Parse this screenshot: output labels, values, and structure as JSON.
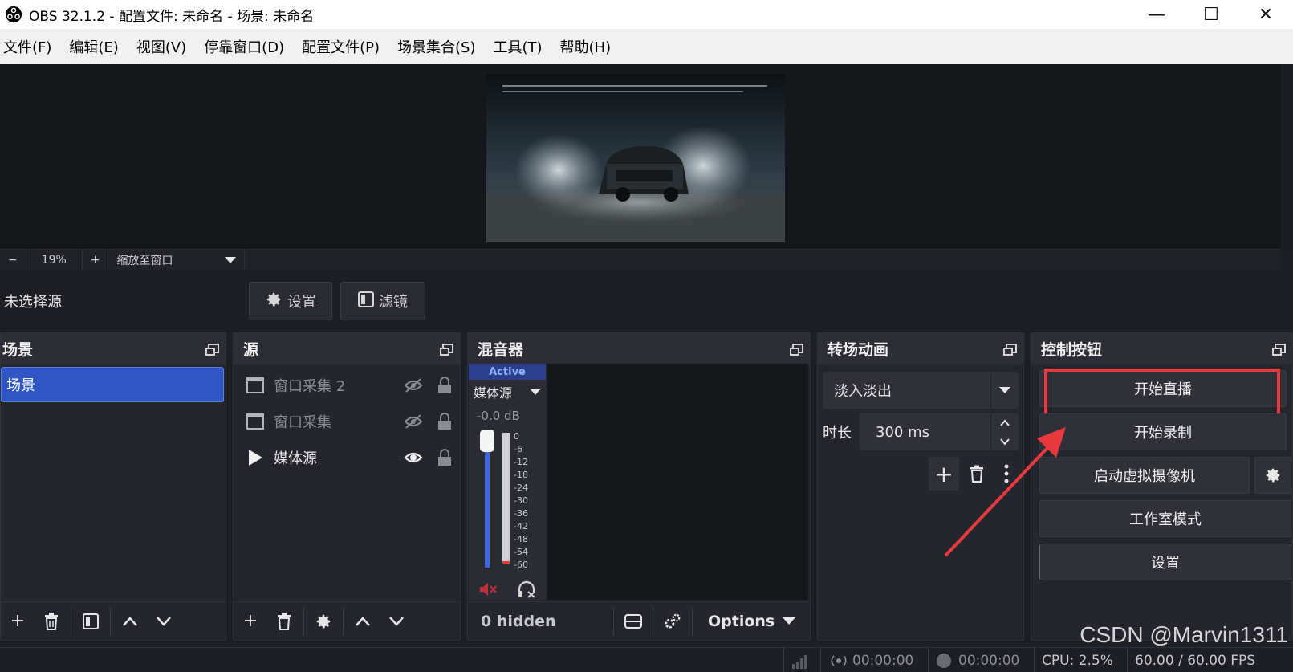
{
  "window": {
    "title": "OBS 32.1.2 - 配置文件: 未命名 - 场景: 未命名",
    "minimize": "—",
    "maximize": "☐",
    "close": "✕"
  },
  "menu": [
    "文件(F)",
    "编辑(E)",
    "视图(V)",
    "停靠窗口(D)",
    "配置文件(P)",
    "场景集合(S)",
    "工具(T)",
    "帮助(H)"
  ],
  "preview": {
    "zoom_minus": "−",
    "zoom_value": "19%",
    "zoom_plus": "+",
    "zoom_mode": "缩放至窗口"
  },
  "source_toolbar": {
    "no_source": "未选择源",
    "settings": "设置",
    "filters": "滤镜"
  },
  "scenes": {
    "title": "场景",
    "items": [
      "场景"
    ]
  },
  "sources": {
    "title": "源",
    "items": [
      {
        "name": "窗口采集 2",
        "visible": false
      },
      {
        "name": "窗口采集",
        "visible": false
      },
      {
        "name": "媒体源",
        "visible": true
      }
    ]
  },
  "mixer": {
    "title": "混音器",
    "active": "Active",
    "channel": "媒体源",
    "db": "-0.0 dB",
    "ticks": [
      "0",
      "-6",
      "-12",
      "-18",
      "-24",
      "-30",
      "-36",
      "-42",
      "-48",
      "-54",
      "-60"
    ],
    "volume_fraction": 1.0,
    "hidden": "0 hidden",
    "options": "Options"
  },
  "transitions": {
    "title": "转场动画",
    "selected": "淡入淡出",
    "duration_label": "时长",
    "duration_value": "300 ms"
  },
  "controls": {
    "title": "控制按钮",
    "start_stream": "开始直播",
    "start_record": "开始录制",
    "virtual_cam": "启动虚拟摄像机",
    "studio_mode": "工作室模式",
    "settings": "设置",
    "highlight_color": "#e8393f"
  },
  "status": {
    "stream_time": "00:00:00",
    "record_time": "00:00:00",
    "cpu": "CPU: 2.5%",
    "fps": "60.00 / 60.00 FPS"
  },
  "watermark": "CSDN @Marvin1311"
}
